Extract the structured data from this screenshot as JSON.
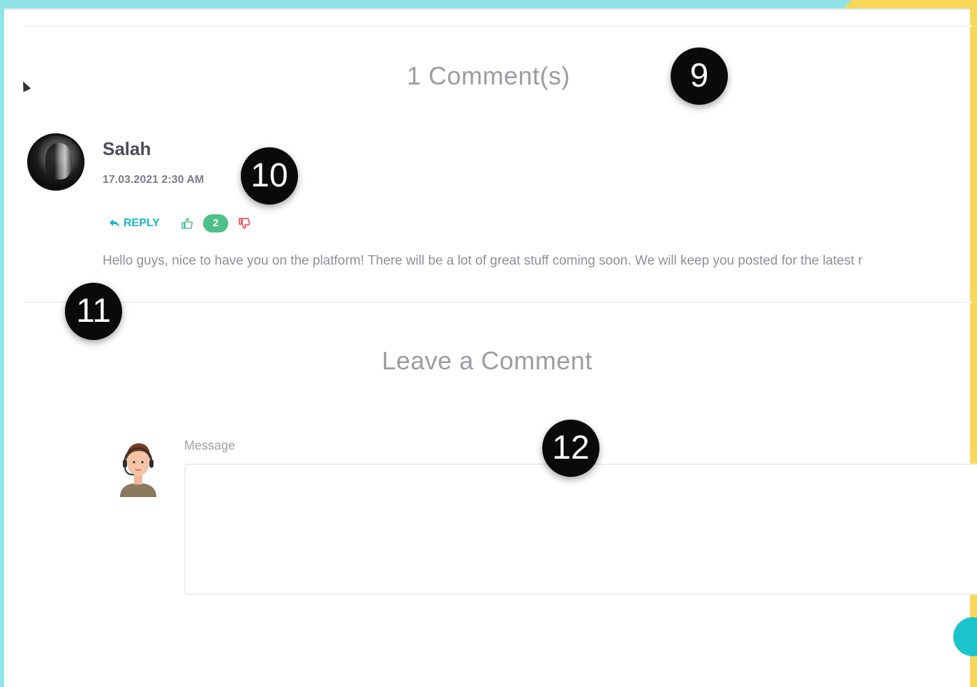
{
  "comments": {
    "count_title": "1 Comment(s)",
    "items": [
      {
        "author": "Salah",
        "timestamp": "17.03.2021 2:30 AM",
        "reply_label": "REPLY",
        "like_count": "2",
        "text": "Hello guys, nice to have you on the platform! There will be a lot of great stuff coming soon. We will keep you posted for the latest r"
      }
    ]
  },
  "leave_comment": {
    "title": "Leave a Comment",
    "message_label": "Message",
    "message_value": ""
  },
  "annotations": [
    "9",
    "10",
    "11",
    "12"
  ],
  "colors": {
    "accent_teal": "#1bb7c7",
    "like_green": "#4cc087",
    "dislike_red": "#f2545b",
    "frame_cyan": "#8fe3e6",
    "frame_yellow": "#f7d75a"
  }
}
